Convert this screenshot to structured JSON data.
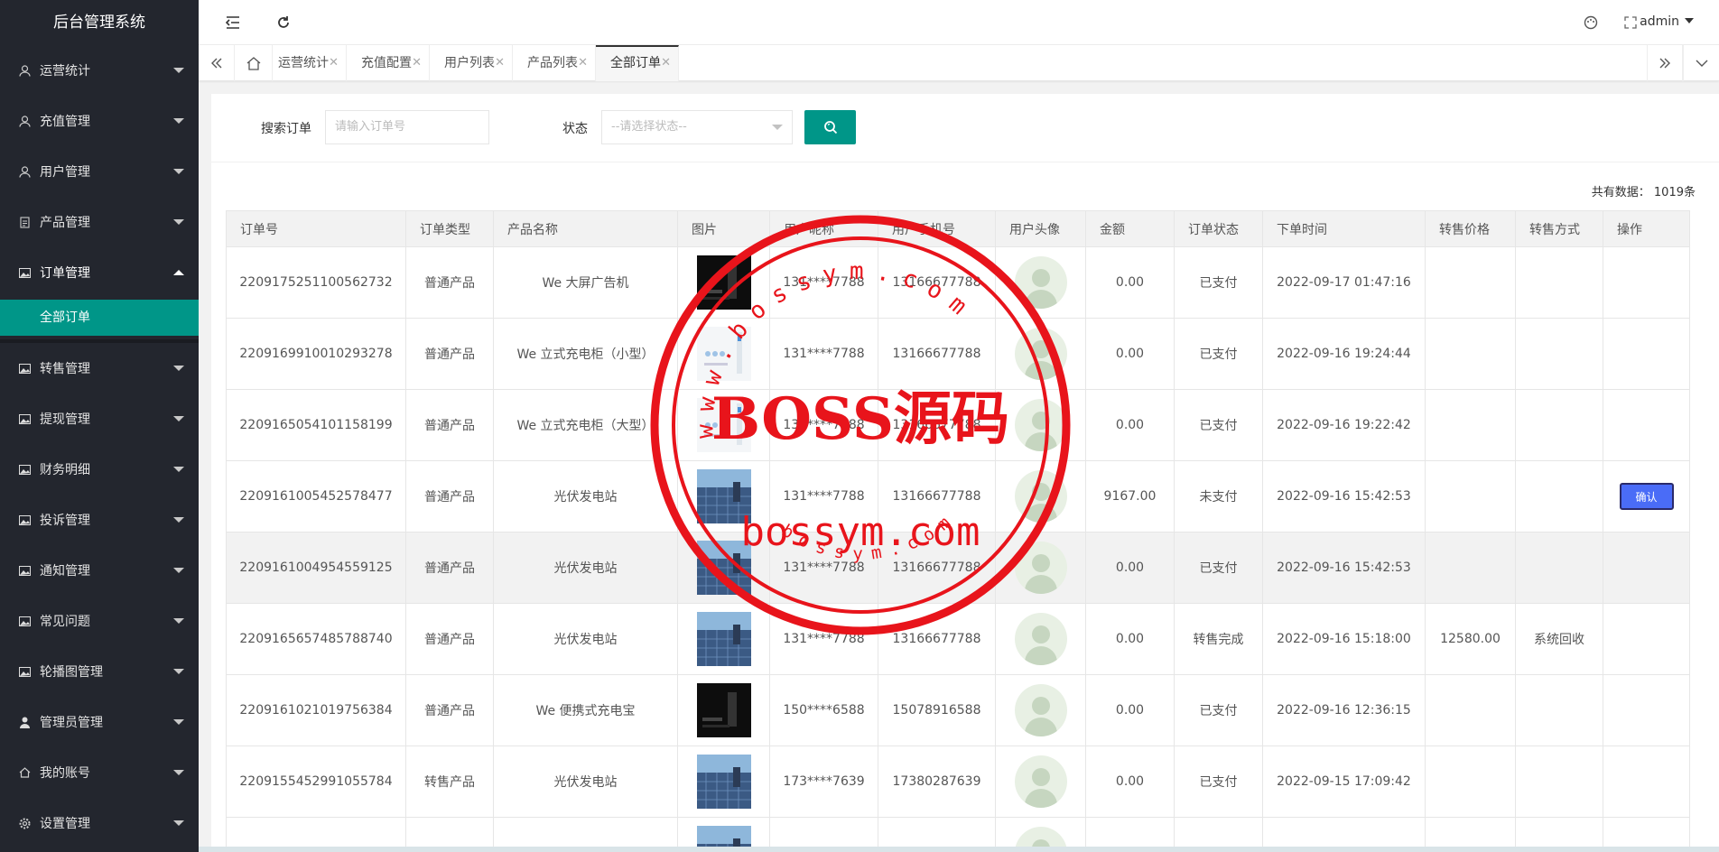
{
  "app": {
    "title": "后台管理系统",
    "user": "admin"
  },
  "sidebar": {
    "items": [
      {
        "label": "运营统计",
        "icon": "user-icon"
      },
      {
        "label": "充值管理",
        "icon": "user-icon"
      },
      {
        "label": "用户管理",
        "icon": "user-icon"
      },
      {
        "label": "产品管理",
        "icon": "document-icon"
      },
      {
        "label": "订单管理",
        "icon": "image-icon",
        "open": true
      },
      {
        "label": "转售管理",
        "icon": "image-icon"
      },
      {
        "label": "提现管理",
        "icon": "image-icon"
      },
      {
        "label": "财务明细",
        "icon": "image-icon"
      },
      {
        "label": "投诉管理",
        "icon": "image-icon"
      },
      {
        "label": "通知管理",
        "icon": "image-icon"
      },
      {
        "label": "常见问题",
        "icon": "image-icon"
      },
      {
        "label": "轮播图管理",
        "icon": "image-icon"
      },
      {
        "label": "管理员管理",
        "icon": "person-icon"
      },
      {
        "label": "我的账号",
        "icon": "home-icon"
      },
      {
        "label": "设置管理",
        "icon": "gear-icon"
      }
    ],
    "submenu": {
      "label": "全部订单"
    }
  },
  "tabs": [
    {
      "label": "运营统计"
    },
    {
      "label": "充值配置"
    },
    {
      "label": "用户列表"
    },
    {
      "label": "产品列表"
    },
    {
      "label": "全部订单",
      "active": true
    }
  ],
  "search": {
    "order_label": "搜索订单",
    "order_placeholder": "请输入订单号",
    "status_label": "状态",
    "status_placeholder": "--请选择状态--"
  },
  "total": "共有数据： 1019条",
  "table": {
    "headers": [
      "订单号",
      "订单类型",
      "产品名称",
      "图片",
      "用户昵称",
      "用户手机号",
      "用户头像",
      "金额",
      "订单状态",
      "下单时间",
      "转售价格",
      "转售方式",
      "操作"
    ],
    "rows": [
      {
        "order": "2209175251100562732",
        "type": "普通产品",
        "product": "We 大屏广告机",
        "thumb": "dark",
        "nick": "131****7788",
        "phone": "13166677788",
        "amount": "0.00",
        "status": "已支付",
        "time": "2022-09-17 01:47:16",
        "resale_price": "",
        "resale_way": "",
        "action": ""
      },
      {
        "order": "2209169910010293278",
        "type": "普通产品",
        "product": "We 立式充电柜（小型）",
        "thumb": "light",
        "nick": "131****7788",
        "phone": "13166677788",
        "amount": "0.00",
        "status": "已支付",
        "time": "2022-09-16 19:24:44",
        "resale_price": "",
        "resale_way": "",
        "action": ""
      },
      {
        "order": "2209165054101158199",
        "type": "普通产品",
        "product": "We 立式充电柜（大型）",
        "thumb": "light",
        "nick": "131****7788",
        "phone": "13166677788",
        "amount": "0.00",
        "status": "已支付",
        "time": "2022-09-16 19:22:42",
        "resale_price": "",
        "resale_way": "",
        "action": ""
      },
      {
        "order": "2209161005452578477",
        "type": "普通产品",
        "product": "光伏发电站",
        "thumb": "solar",
        "nick": "131****7788",
        "phone": "13166677788",
        "amount": "9167.00",
        "status": "未支付",
        "time": "2022-09-16 15:42:53",
        "resale_price": "",
        "resale_way": "",
        "action": "确认"
      },
      {
        "order": "2209161004954559125",
        "type": "普通产品",
        "product": "光伏发电站",
        "thumb": "solar",
        "nick": "131****7788",
        "phone": "13166677788",
        "amount": "0.00",
        "status": "已支付",
        "time": "2022-09-16 15:42:53",
        "resale_price": "",
        "resale_way": "",
        "action": "",
        "highlight": true
      },
      {
        "order": "2209165657485788740",
        "type": "普通产品",
        "product": "光伏发电站",
        "thumb": "solar",
        "nick": "131****7788",
        "phone": "13166677788",
        "amount": "0.00",
        "status": "转售完成",
        "time": "2022-09-16 15:18:00",
        "resale_price": "12580.00",
        "resale_way": "系统回收",
        "action": ""
      },
      {
        "order": "2209161021019756384",
        "type": "普通产品",
        "product": "We 便携式充电宝",
        "thumb": "dark",
        "nick": "150****6588",
        "phone": "15078916588",
        "amount": "0.00",
        "status": "已支付",
        "time": "2022-09-16 12:36:15",
        "resale_price": "",
        "resale_way": "",
        "action": ""
      },
      {
        "order": "2209155452991055784",
        "type": "转售产品",
        "product": "光伏发电站",
        "thumb": "solar",
        "nick": "173****7639",
        "phone": "17380287639",
        "amount": "0.00",
        "status": "已支付",
        "time": "2022-09-15 17:09:42",
        "resale_price": "",
        "resale_way": "",
        "action": ""
      },
      {
        "order": "",
        "type": "",
        "product": "",
        "thumb": "solar",
        "nick": "",
        "phone": "",
        "amount": "",
        "status": "",
        "time": "",
        "resale_price": "",
        "resale_way": "",
        "action": ""
      }
    ]
  },
  "watermark": {
    "top_text": "www.bossym.com",
    "main_text": "BOSS源码",
    "url_text": "bossym.com",
    "bottom_text": "bossym.com",
    "color": "#e8141b"
  },
  "colors": {
    "sidebar": "#23262e",
    "accent": "#009688",
    "confirm": "#4a6cf7"
  }
}
